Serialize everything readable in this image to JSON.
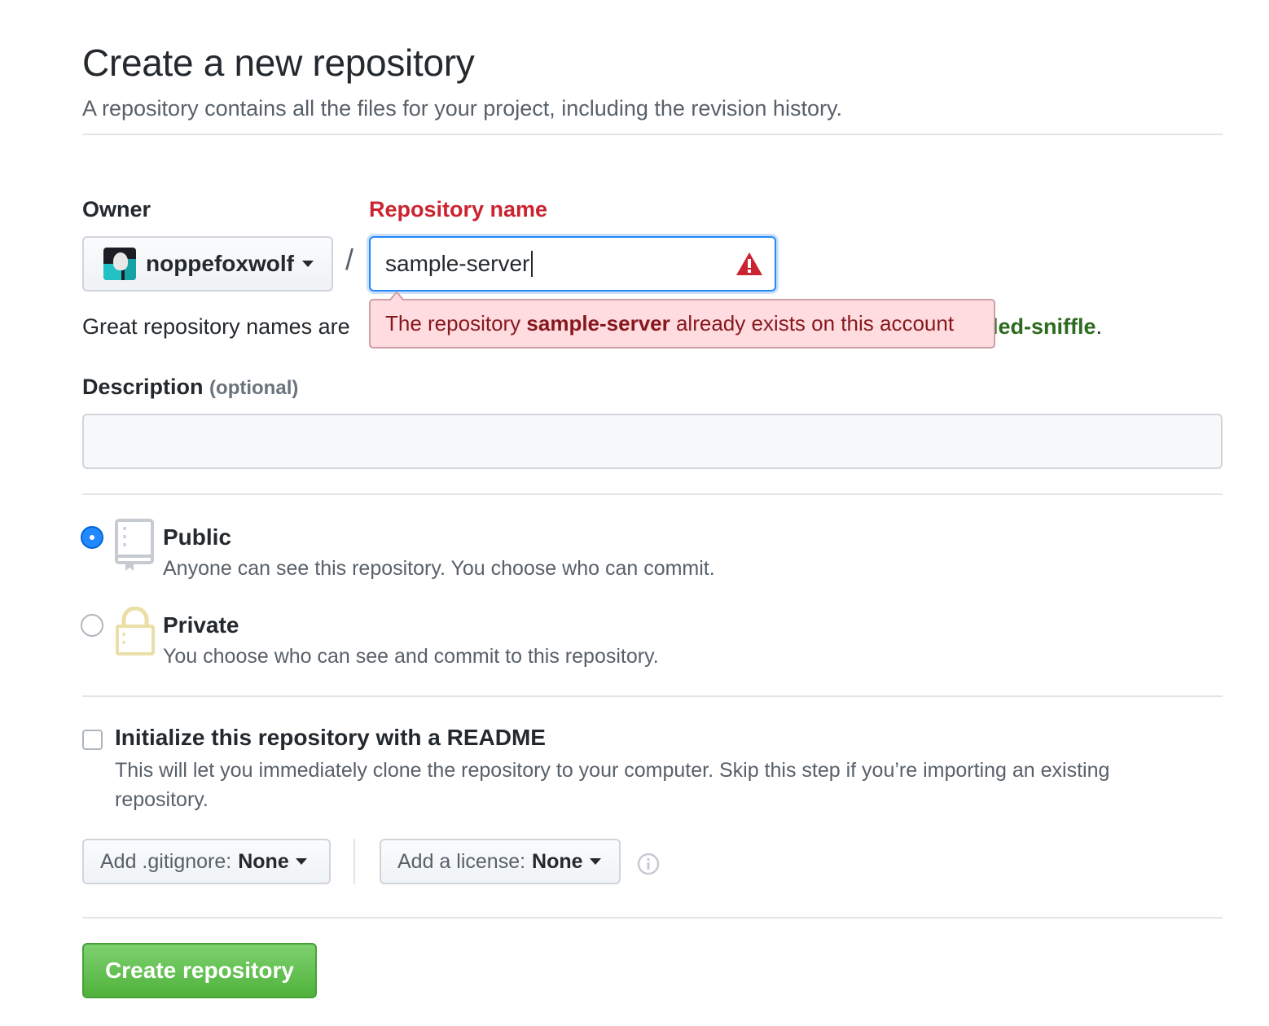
{
  "header": {
    "title": "Create a new repository",
    "subtitle": "A repository contains all the files for your project, including the revision history."
  },
  "owner": {
    "label": "Owner",
    "selected": "noppefoxwolf",
    "avatar_icon": "user-avatar"
  },
  "repo_name": {
    "label": "Repository name",
    "separator": "/",
    "value": "sample-server",
    "status_icon": "alert-icon",
    "error_prefix": "The repository ",
    "error_name": "sample-server",
    "error_suffix": " already exists on this account"
  },
  "hint": {
    "text_start": "Great repository names are",
    "text_end_highlight": "led-sniffle",
    "text_end": "."
  },
  "description": {
    "label": "Description",
    "optional": "(optional)",
    "value": ""
  },
  "visibility": {
    "selected": "public",
    "options": [
      {
        "id": "public",
        "title": "Public",
        "desc": "Anyone can see this repository. You choose who can commit.",
        "icon": "repo-icon"
      },
      {
        "id": "private",
        "title": "Private",
        "desc": "You choose who can see and commit to this repository.",
        "icon": "lock-icon"
      }
    ]
  },
  "readme": {
    "checked": false,
    "title": "Initialize this repository with a README",
    "desc": "This will let you immediately clone the repository to your computer. Skip this step if you’re importing an existing repository."
  },
  "gitignore": {
    "label": "Add .gitignore:",
    "value": "None"
  },
  "license": {
    "label": "Add a license:",
    "value": "None"
  },
  "info_icon": "info-icon",
  "submit": {
    "label": "Create repository"
  },
  "colors": {
    "error": "#cb2431",
    "accent_blue": "#2188ff",
    "success_green": "#28a745"
  }
}
